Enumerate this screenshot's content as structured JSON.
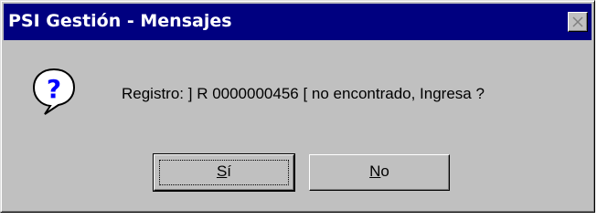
{
  "window": {
    "title": "PSI Gestión - Mensajes"
  },
  "icons": {
    "close": "close-x-icon",
    "message": "question-mark-icon"
  },
  "dialog": {
    "message": "Registro: ] R 0000000456 [ no encontrado, Ingresa ?"
  },
  "buttons": {
    "yes": {
      "mnemonic": "S",
      "rest": "í",
      "default": true
    },
    "no": {
      "mnemonic": "N",
      "rest": "o",
      "default": false
    }
  },
  "colors": {
    "titlebar": "#000080",
    "face": "#c0c0c0",
    "icon_blue": "#0000ff"
  }
}
